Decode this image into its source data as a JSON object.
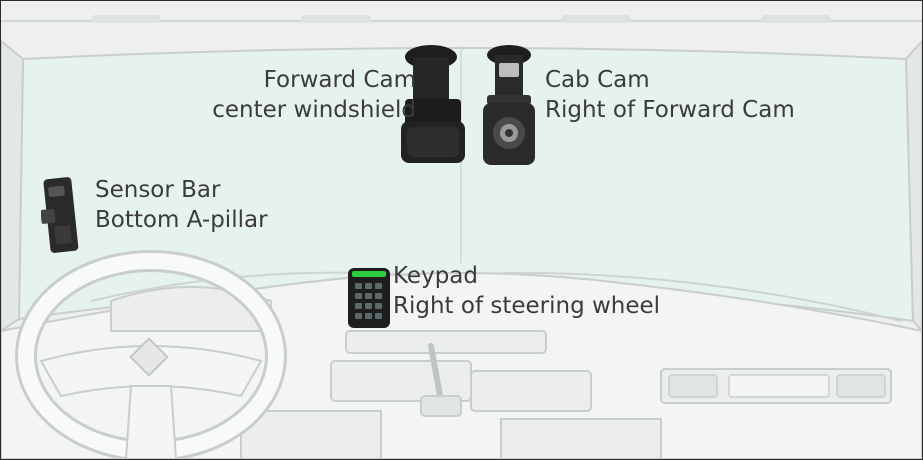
{
  "diagram": {
    "components": [
      {
        "id": "forward-cam",
        "name": "Forward Cam",
        "location": "center windshield"
      },
      {
        "id": "cab-cam",
        "name": "Cab Cam",
        "location": "Right of Forward Cam"
      },
      {
        "id": "sensor-bar",
        "name": "Sensor Bar",
        "location": "Bottom A-pillar"
      },
      {
        "id": "keypad",
        "name": "Keypad",
        "location": "Right of steering wheel"
      }
    ]
  },
  "colors": {
    "outline": "#c9cdcd",
    "windshield": "#e6f2f0",
    "dash": "#f3f4f4",
    "label_text": "#3b3b3b",
    "device_dark": "#1e1e1e",
    "keypad_led": "#2ecc40"
  }
}
